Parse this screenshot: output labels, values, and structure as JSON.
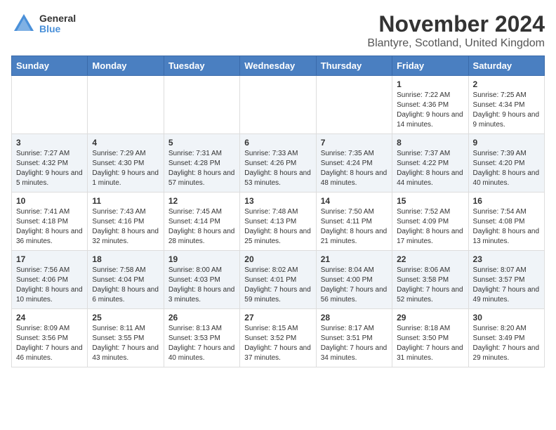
{
  "logo": {
    "line1": "General",
    "line2": "Blue"
  },
  "title": "November 2024",
  "subtitle": "Blantyre, Scotland, United Kingdom",
  "days_of_week": [
    "Sunday",
    "Monday",
    "Tuesday",
    "Wednesday",
    "Thursday",
    "Friday",
    "Saturday"
  ],
  "weeks": [
    [
      {
        "day": "",
        "info": ""
      },
      {
        "day": "",
        "info": ""
      },
      {
        "day": "",
        "info": ""
      },
      {
        "day": "",
        "info": ""
      },
      {
        "day": "",
        "info": ""
      },
      {
        "day": "1",
        "info": "Sunrise: 7:22 AM\nSunset: 4:36 PM\nDaylight: 9 hours and 14 minutes."
      },
      {
        "day": "2",
        "info": "Sunrise: 7:25 AM\nSunset: 4:34 PM\nDaylight: 9 hours and 9 minutes."
      }
    ],
    [
      {
        "day": "3",
        "info": "Sunrise: 7:27 AM\nSunset: 4:32 PM\nDaylight: 9 hours and 5 minutes."
      },
      {
        "day": "4",
        "info": "Sunrise: 7:29 AM\nSunset: 4:30 PM\nDaylight: 9 hours and 1 minute."
      },
      {
        "day": "5",
        "info": "Sunrise: 7:31 AM\nSunset: 4:28 PM\nDaylight: 8 hours and 57 minutes."
      },
      {
        "day": "6",
        "info": "Sunrise: 7:33 AM\nSunset: 4:26 PM\nDaylight: 8 hours and 53 minutes."
      },
      {
        "day": "7",
        "info": "Sunrise: 7:35 AM\nSunset: 4:24 PM\nDaylight: 8 hours and 48 minutes."
      },
      {
        "day": "8",
        "info": "Sunrise: 7:37 AM\nSunset: 4:22 PM\nDaylight: 8 hours and 44 minutes."
      },
      {
        "day": "9",
        "info": "Sunrise: 7:39 AM\nSunset: 4:20 PM\nDaylight: 8 hours and 40 minutes."
      }
    ],
    [
      {
        "day": "10",
        "info": "Sunrise: 7:41 AM\nSunset: 4:18 PM\nDaylight: 8 hours and 36 minutes."
      },
      {
        "day": "11",
        "info": "Sunrise: 7:43 AM\nSunset: 4:16 PM\nDaylight: 8 hours and 32 minutes."
      },
      {
        "day": "12",
        "info": "Sunrise: 7:45 AM\nSunset: 4:14 PM\nDaylight: 8 hours and 28 minutes."
      },
      {
        "day": "13",
        "info": "Sunrise: 7:48 AM\nSunset: 4:13 PM\nDaylight: 8 hours and 25 minutes."
      },
      {
        "day": "14",
        "info": "Sunrise: 7:50 AM\nSunset: 4:11 PM\nDaylight: 8 hours and 21 minutes."
      },
      {
        "day": "15",
        "info": "Sunrise: 7:52 AM\nSunset: 4:09 PM\nDaylight: 8 hours and 17 minutes."
      },
      {
        "day": "16",
        "info": "Sunrise: 7:54 AM\nSunset: 4:08 PM\nDaylight: 8 hours and 13 minutes."
      }
    ],
    [
      {
        "day": "17",
        "info": "Sunrise: 7:56 AM\nSunset: 4:06 PM\nDaylight: 8 hours and 10 minutes."
      },
      {
        "day": "18",
        "info": "Sunrise: 7:58 AM\nSunset: 4:04 PM\nDaylight: 8 hours and 6 minutes."
      },
      {
        "day": "19",
        "info": "Sunrise: 8:00 AM\nSunset: 4:03 PM\nDaylight: 8 hours and 3 minutes."
      },
      {
        "day": "20",
        "info": "Sunrise: 8:02 AM\nSunset: 4:01 PM\nDaylight: 7 hours and 59 minutes."
      },
      {
        "day": "21",
        "info": "Sunrise: 8:04 AM\nSunset: 4:00 PM\nDaylight: 7 hours and 56 minutes."
      },
      {
        "day": "22",
        "info": "Sunrise: 8:06 AM\nSunset: 3:58 PM\nDaylight: 7 hours and 52 minutes."
      },
      {
        "day": "23",
        "info": "Sunrise: 8:07 AM\nSunset: 3:57 PM\nDaylight: 7 hours and 49 minutes."
      }
    ],
    [
      {
        "day": "24",
        "info": "Sunrise: 8:09 AM\nSunset: 3:56 PM\nDaylight: 7 hours and 46 minutes."
      },
      {
        "day": "25",
        "info": "Sunrise: 8:11 AM\nSunset: 3:55 PM\nDaylight: 7 hours and 43 minutes."
      },
      {
        "day": "26",
        "info": "Sunrise: 8:13 AM\nSunset: 3:53 PM\nDaylight: 7 hours and 40 minutes."
      },
      {
        "day": "27",
        "info": "Sunrise: 8:15 AM\nSunset: 3:52 PM\nDaylight: 7 hours and 37 minutes."
      },
      {
        "day": "28",
        "info": "Sunrise: 8:17 AM\nSunset: 3:51 PM\nDaylight: 7 hours and 34 minutes."
      },
      {
        "day": "29",
        "info": "Sunrise: 8:18 AM\nSunset: 3:50 PM\nDaylight: 7 hours and 31 minutes."
      },
      {
        "day": "30",
        "info": "Sunrise: 8:20 AM\nSunset: 3:49 PM\nDaylight: 7 hours and 29 minutes."
      }
    ]
  ]
}
